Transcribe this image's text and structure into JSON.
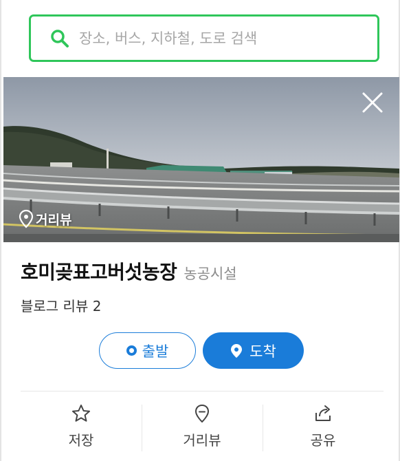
{
  "search": {
    "placeholder": "장소, 버스, 지하철, 도로 검색",
    "icon": "search-icon",
    "accent_color": "#2fc65a"
  },
  "photo": {
    "badge_label": "거리뷰",
    "close_icon": "close-icon"
  },
  "place": {
    "name": "호미곶표고버섯농장",
    "category": "농공시설",
    "review_text": "블로그 리뷰 2"
  },
  "route": {
    "depart_label": "출발",
    "arrive_label": "도착",
    "accent_color": "#1a7cd9"
  },
  "actions": [
    {
      "label": "저장",
      "icon": "star-icon"
    },
    {
      "label": "거리뷰",
      "icon": "roadview-pin-icon"
    },
    {
      "label": "공유",
      "icon": "share-icon"
    }
  ]
}
